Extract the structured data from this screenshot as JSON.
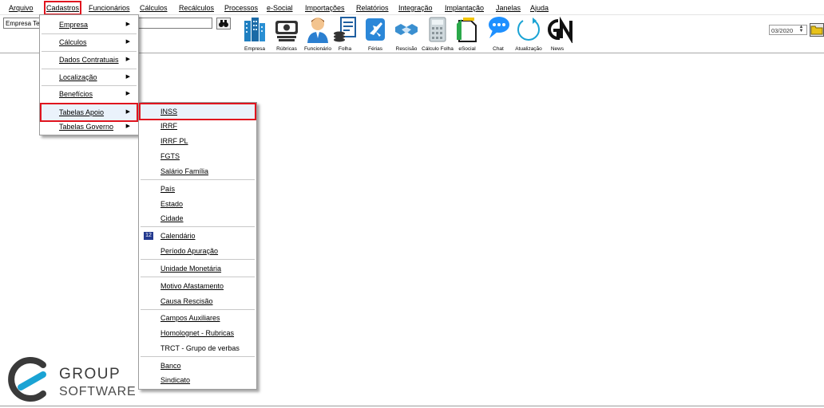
{
  "menu": {
    "items": [
      "Arquivo",
      "Cadastros",
      "Funcionários",
      "Cálculos",
      "Recálculos",
      "Processos",
      "e-Social",
      "Importações",
      "Relatórios",
      "Integração",
      "Implantação",
      "Janelas",
      "Ajuda"
    ],
    "active": "Cadastros"
  },
  "toolbar": {
    "empresa_value": "Empresa Te",
    "buttons": [
      {
        "label": "Empresa",
        "icon": "building-icon"
      },
      {
        "label": "Rúbricas",
        "icon": "cash-icon"
      },
      {
        "label": "Funcionário",
        "icon": "employee-icon"
      },
      {
        "label": "Folha",
        "icon": "payroll-icon"
      },
      {
        "label": "Férias",
        "icon": "vacation-plane-icon"
      },
      {
        "label": "Rescisão",
        "icon": "handshake-icon"
      },
      {
        "label": "Cálculo Folha",
        "icon": "calculator-icon"
      },
      {
        "label": "eSocial",
        "icon": "esocial-icon"
      },
      {
        "label": "Chat",
        "icon": "chat-bubble-icon"
      },
      {
        "label": "Atualização",
        "icon": "refresh-icon"
      },
      {
        "label": "News",
        "icon": "gn-logo-icon"
      }
    ],
    "period_value": "03/2020"
  },
  "cadastros_menu": {
    "items": [
      {
        "label": "Empresa",
        "has_submenu": true
      },
      {
        "label": "Cálculos",
        "has_submenu": true
      },
      {
        "label": "Dados Contratuais",
        "has_submenu": true
      },
      {
        "label": "Localização",
        "has_submenu": true
      },
      {
        "label": "Benefícios",
        "has_submenu": true
      },
      {
        "label": "Tabelas Apoio",
        "has_submenu": true,
        "highlighted": true
      },
      {
        "label": "Tabelas Governo",
        "has_submenu": true
      }
    ]
  },
  "tabelas_apoio_menu": {
    "items": [
      "INSS",
      "IRRF",
      "IRRF PL",
      "FGTS",
      "Salário Família",
      "País",
      "Estado",
      "Cidade",
      "Calendário",
      "Período Apuração",
      "Unidade Monetária",
      "Motivo Afastamento",
      "Causa Rescisão",
      "Campos Auxiliares",
      "Homolognet - Rubricas",
      "TRCT - Grupo de verbas",
      "Banco",
      "Sindicato"
    ],
    "highlighted": "INSS"
  },
  "logo": {
    "line1": "GROUP",
    "line2": "SOFTWARE"
  },
  "colors": {
    "highlight": "#e0141e",
    "logo_blue": "#1aa3d4",
    "logo_gray": "#3a3a3a"
  }
}
